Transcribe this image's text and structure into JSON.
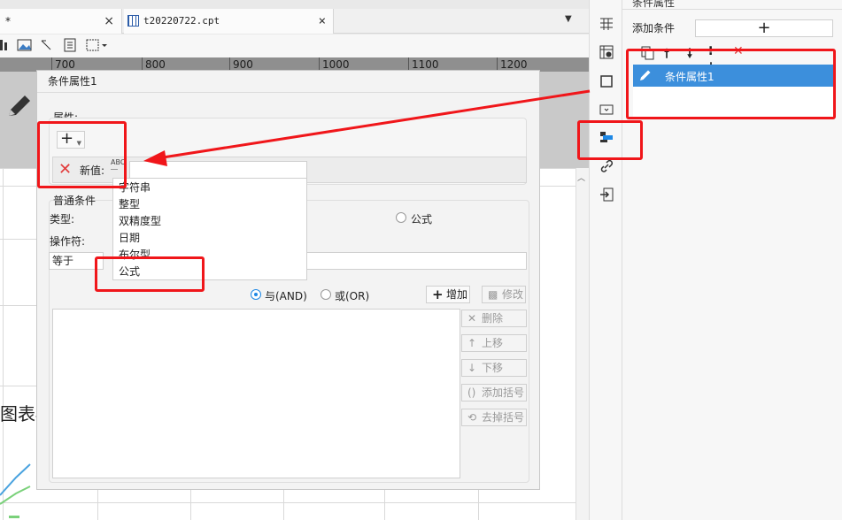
{
  "tabs": [
    {
      "label": "*",
      "close": "×"
    },
    {
      "label": "t20220722.cpt",
      "close": "×"
    }
  ],
  "tab_menu_glyph": "▼",
  "ruler_labels": [
    "700",
    "800",
    "900",
    "1000",
    "1100",
    "1200"
  ],
  "background_chart_title": "图表标题",
  "right_panel": {
    "title": "条件属性",
    "add_condition_label": "添加条件",
    "add_condition_button": "+",
    "selected_condition": "条件属性1"
  },
  "dialog": {
    "title": "条件属性1",
    "attribute_label": "属性:",
    "attribute_add": "+",
    "new_value_label": "新值:",
    "type_icon_text": "ABC",
    "common_condition_label": "普通条件",
    "type_label": "类型:",
    "formula_radio_label": "公式",
    "operator_label": "操作符:",
    "operator_value": "等于",
    "and_label": "与(AND)",
    "or_label": "或(OR)",
    "buttons": {
      "add": "增加",
      "modify": "修改",
      "delete": "删除",
      "move_up": "上移",
      "move_down": "下移",
      "add_bracket": "添加括号",
      "remove_bracket": "去掉括号"
    }
  },
  "type_dropdown": {
    "options": [
      "字符串",
      "整型",
      "双精度型",
      "日期",
      "布尔型",
      "公式"
    ],
    "highlighted": "公式"
  },
  "colors": {
    "annotation_red": "#f0161a",
    "selection_blue": "#3c8fdc",
    "delete_red": "#e23b3b"
  }
}
